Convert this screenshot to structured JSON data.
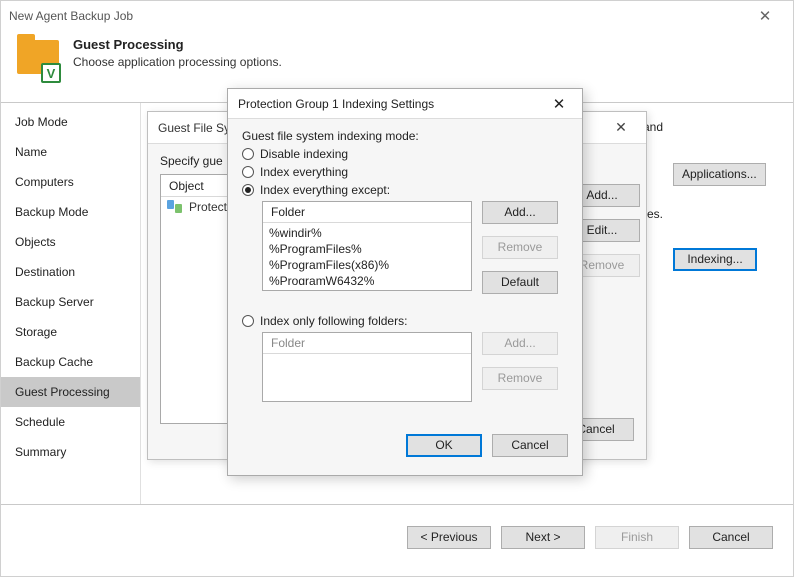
{
  "window": {
    "title": "New Agent Backup Job",
    "close_glyph": "✕"
  },
  "header": {
    "title": "Guest Processing",
    "subtitle": "Choose application processing options.",
    "badge": "V"
  },
  "nav": {
    "items": [
      {
        "label": "Job Mode"
      },
      {
        "label": "Name"
      },
      {
        "label": "Computers"
      },
      {
        "label": "Backup Mode"
      },
      {
        "label": "Objects"
      },
      {
        "label": "Destination"
      },
      {
        "label": "Backup Server"
      },
      {
        "label": "Storage"
      },
      {
        "label": "Backup Cache"
      },
      {
        "label": "Guest Processing",
        "selected": true
      },
      {
        "label": "Schedule"
      },
      {
        "label": "Summary"
      }
    ]
  },
  "main": {
    "text_fragment_1": "s processing, and",
    "text_fragment_2": "f individual files.",
    "applications_btn": "Applications...",
    "indexing_btn": "Indexing..."
  },
  "footer": {
    "previous": "< Previous",
    "next": "Next >",
    "finish": "Finish",
    "cancel": "Cancel"
  },
  "dlg1": {
    "title_prefix": "Guest File Sys",
    "specify": "Specify gue",
    "col_object": "Object",
    "row0": "Protecti",
    "add": "Add...",
    "edit": "Edit...",
    "remove": "Remove",
    "cancel": "Cancel",
    "close_glyph": "✕"
  },
  "dlg2": {
    "title": "Protection Group 1 Indexing Settings",
    "close_glyph": "✕",
    "mode_label": "Guest file system indexing mode:",
    "opt_disable": "Disable indexing",
    "opt_everything": "Index everything",
    "opt_except": "Index everything except:",
    "opt_only": "Index only following folders:",
    "folder_header": "Folder",
    "except_folders": [
      "%windir%",
      "%ProgramFiles%",
      "%ProgramFiles(x86)%",
      "%ProgramW6432%"
    ],
    "add": "Add...",
    "remove": "Remove",
    "default": "Default",
    "ok": "OK",
    "cancel": "Cancel"
  }
}
